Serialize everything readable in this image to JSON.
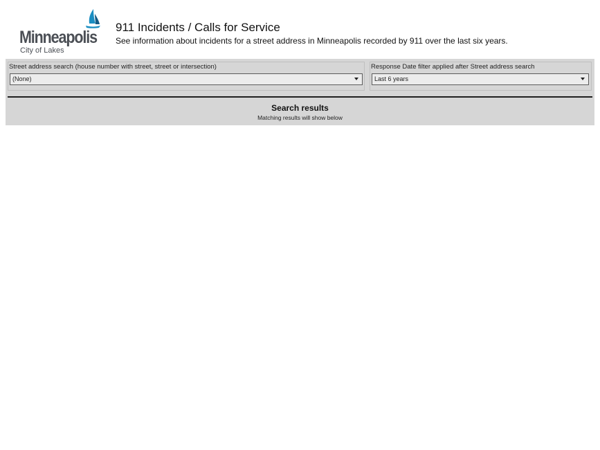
{
  "brand": {
    "name": "Minneapolis",
    "tagline": "City of Lakes",
    "accent_color": "#1b8ec2",
    "dark_accent_color": "#155b86",
    "text_color": "#4b4f55",
    "icon": "sailboat-icon"
  },
  "header": {
    "title": "911 Incidents / Calls for Service",
    "subtitle": "See information about incidents for a street address in Minneapolis recorded by 911 over the last six years."
  },
  "filters": {
    "address": {
      "label": "Street address search (house number with street, street or intersection)",
      "value": "(None)"
    },
    "date": {
      "label": "Response Date filter applied after Street address search",
      "value": "Last 6 years"
    }
  },
  "results": {
    "title": "Search results",
    "hint": "Matching results will show below"
  },
  "colors": {
    "panel_background": "#d6d6d6",
    "divider": "#1f1f1f"
  }
}
